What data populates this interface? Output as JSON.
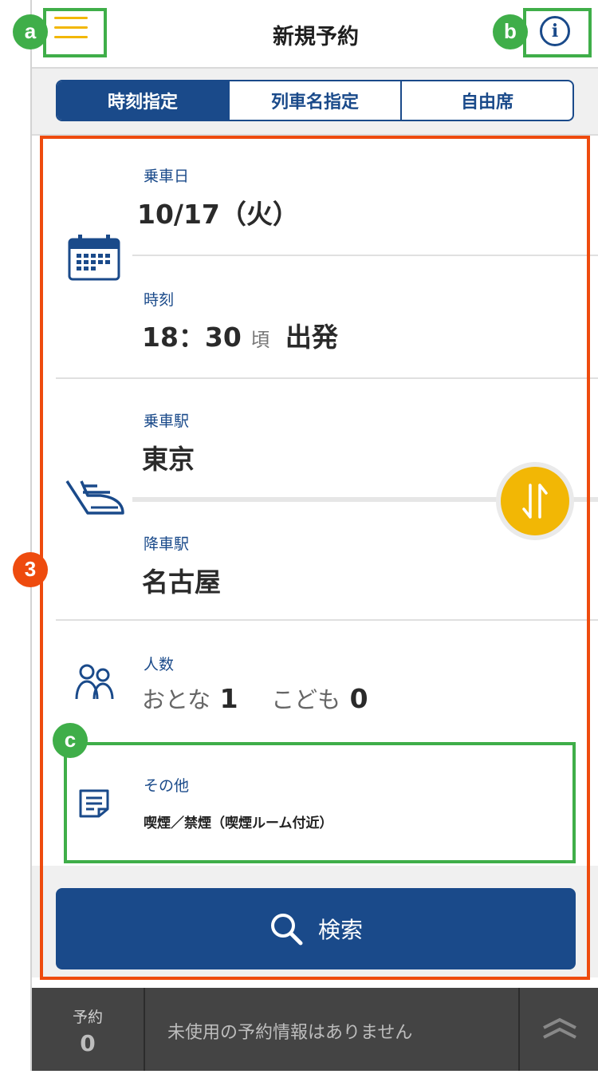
{
  "header": {
    "title": "新規予約",
    "menu_icon": "hamburger-menu-icon",
    "info_icon": "info-icon"
  },
  "tabs": [
    {
      "label": "時刻指定",
      "active": true
    },
    {
      "label": "列車名指定",
      "active": false
    },
    {
      "label": "自由席",
      "active": false
    }
  ],
  "date_field": {
    "label": "乗車日",
    "value": "10/17（火）",
    "icon": "calendar-icon"
  },
  "time_field": {
    "label": "時刻",
    "time": "18：30",
    "approx": "頃",
    "mode": "出発"
  },
  "departure_field": {
    "label": "乗車駅",
    "value": "東京",
    "icon": "train-icon"
  },
  "arrival_field": {
    "label": "降車駅",
    "value": "名古屋"
  },
  "swap_button": {
    "icon": "swap-arrows-icon"
  },
  "passengers": {
    "label": "人数",
    "adult_label": "おとな",
    "adult_count": "1",
    "child_label": "こども",
    "child_count": "0",
    "icon": "people-icon"
  },
  "other": {
    "label": "その他",
    "value": "喫煙／禁煙（喫煙ルーム付近）",
    "icon": "note-icon"
  },
  "search_button": {
    "label": "検索",
    "icon": "search-icon"
  },
  "bottom_bar": {
    "reservation_label": "予約",
    "reservation_count": "0",
    "message": "未使用の予約情報はありません",
    "expand_icon": "chevron-double-up-icon"
  },
  "annotations": {
    "a": "a",
    "b": "b",
    "c": "c",
    "n3": "3"
  },
  "colors": {
    "primary": "#1a4a8a",
    "accent": "#f2b705",
    "annotation_green": "#3fae49",
    "annotation_orange": "#ee4b0e"
  }
}
